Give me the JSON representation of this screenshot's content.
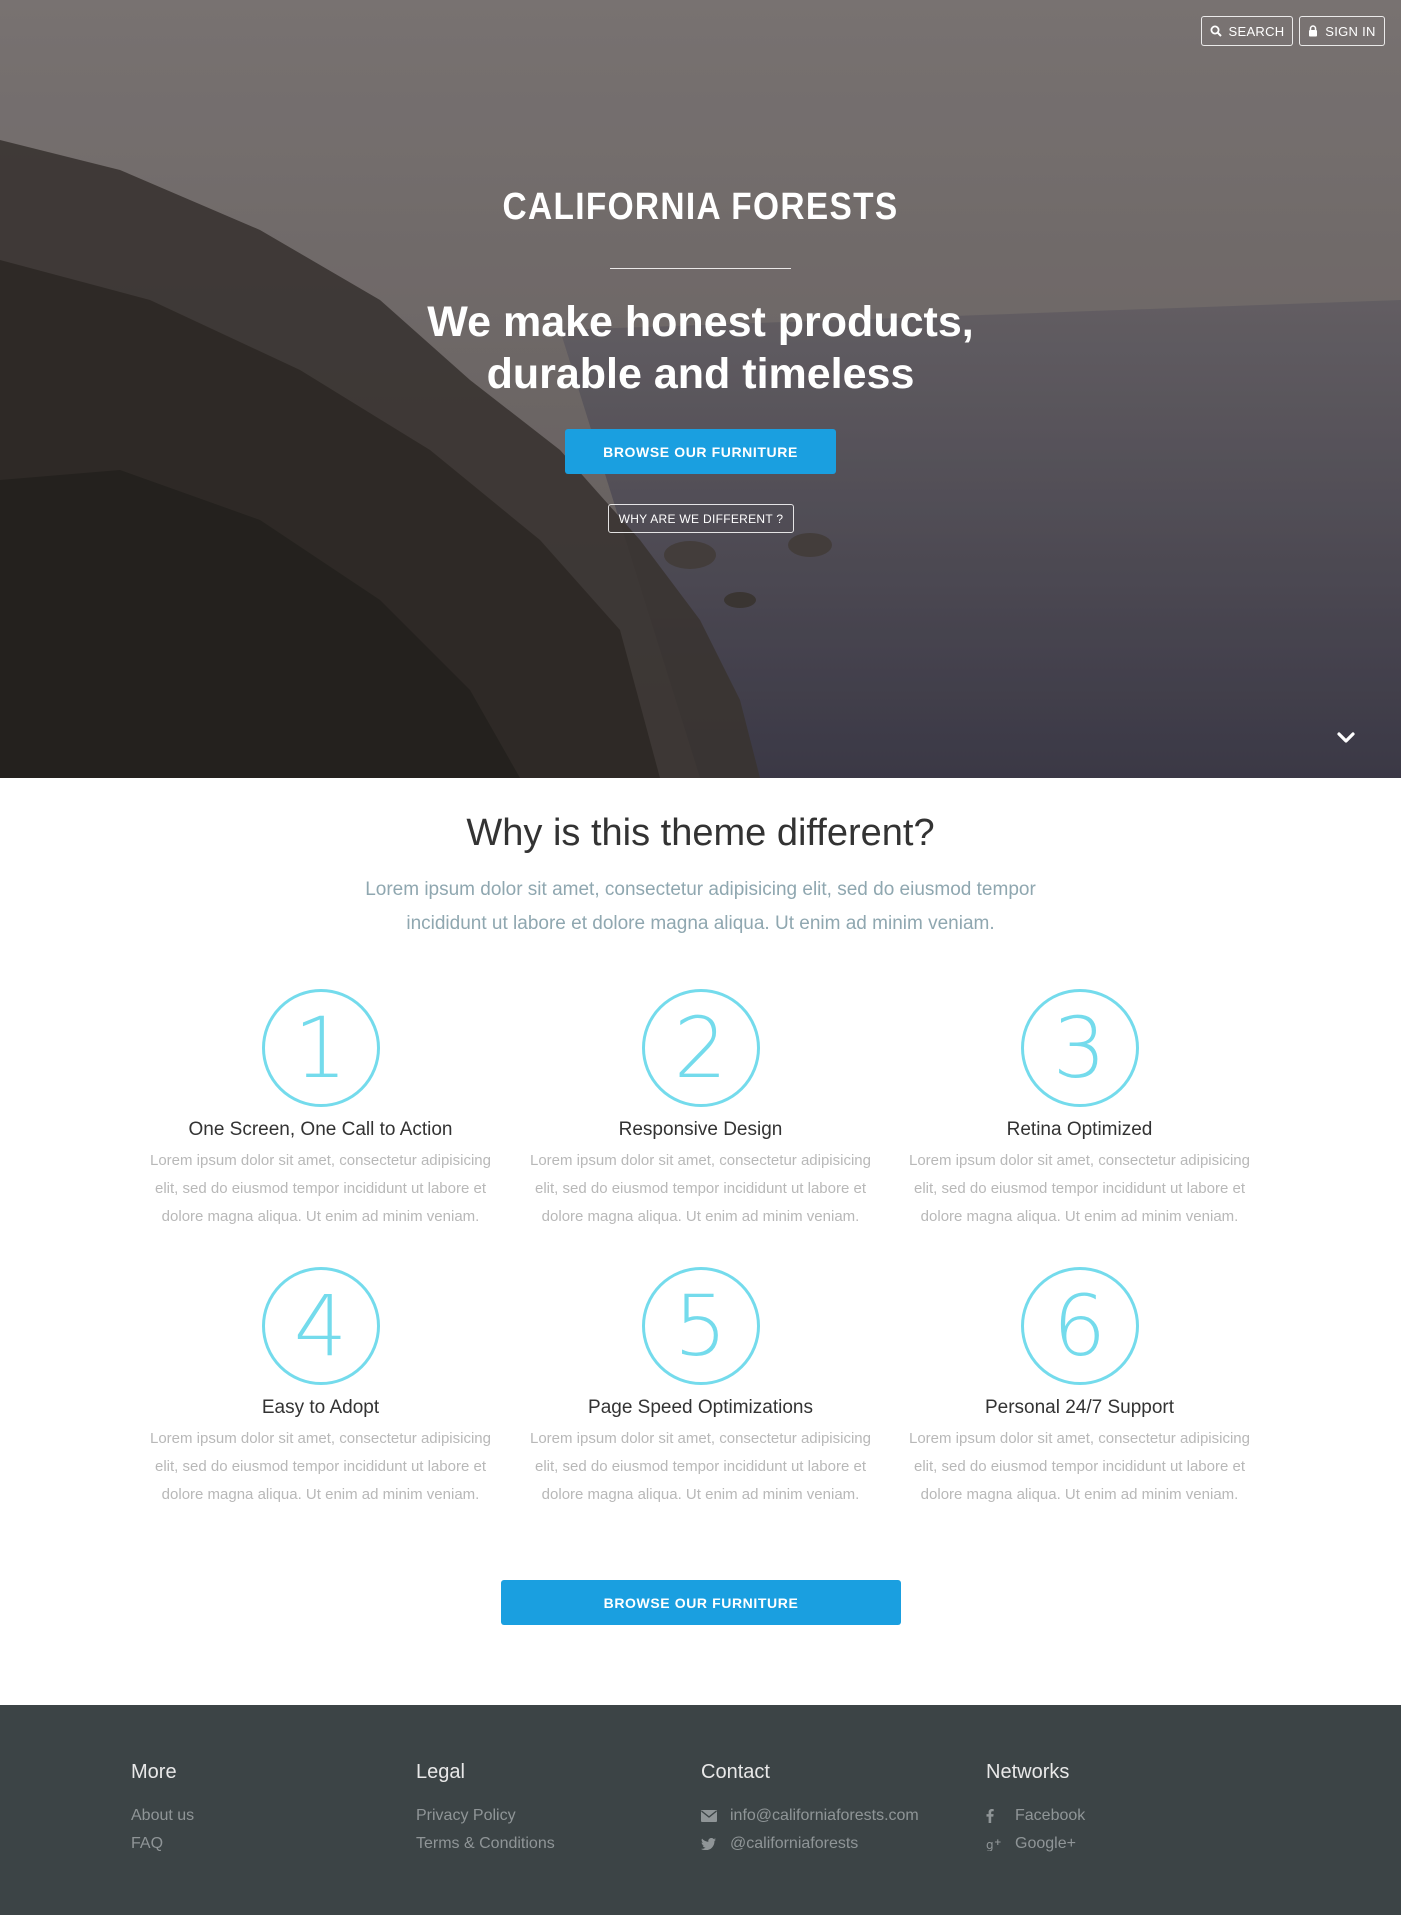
{
  "header": {
    "search_label": "SEARCH",
    "signin_label": "SIGN IN"
  },
  "hero": {
    "brand": "CALIFORNIA FORESTS",
    "headline_line1": "We make honest products,",
    "headline_line2": "durable and timeless",
    "cta_label": "BROWSE OUR FURNITURE",
    "secondary_label": "WHY ARE WE DIFFERENT ?"
  },
  "features": {
    "title": "Why is this theme different?",
    "subtitle": "Lorem ipsum dolor sit amet, consectetur adipisicing elit, sed do eiusmod tempor incididunt ut labore et dolore magna aliqua. Ut enim ad minim veniam.",
    "items": [
      {
        "number": "1",
        "title": "One Screen, One Call to Action",
        "text": "Lorem ipsum dolor sit amet, consectetur adipisicing elit, sed do eiusmod tempor incididunt ut labore et dolore magna aliqua. Ut enim ad minim veniam."
      },
      {
        "number": "2",
        "title": "Responsive Design",
        "text": "Lorem ipsum dolor sit amet, consectetur adipisicing elit, sed do eiusmod tempor incididunt ut labore et dolore magna aliqua. Ut enim ad minim veniam."
      },
      {
        "number": "3",
        "title": "Retina Optimized",
        "text": "Lorem ipsum dolor sit amet, consectetur adipisicing elit, sed do eiusmod tempor incididunt ut labore et dolore magna aliqua. Ut enim ad minim veniam."
      },
      {
        "number": "4",
        "title": "Easy to Adopt",
        "text": "Lorem ipsum dolor sit amet, consectetur adipisicing elit, sed do eiusmod tempor incididunt ut labore et dolore magna aliqua. Ut enim ad minim veniam."
      },
      {
        "number": "5",
        "title": "Page Speed Optimizations",
        "text": "Lorem ipsum dolor sit amet, consectetur adipisicing elit, sed do eiusmod tempor incididunt ut labore et dolore magna aliqua. Ut enim ad minim veniam."
      },
      {
        "number": "6",
        "title": "Personal 24/7 Support",
        "text": "Lorem ipsum dolor sit amet, consectetur adipisicing elit, sed do eiusmod tempor incididunt ut labore et dolore magna aliqua. Ut enim ad minim veniam."
      }
    ],
    "cta_label": "BROWSE OUR FURNITURE"
  },
  "footer": {
    "more": {
      "title": "More",
      "links": [
        "About us",
        "FAQ"
      ]
    },
    "legal": {
      "title": "Legal",
      "links": [
        "Privacy Policy",
        "Terms & Conditions"
      ]
    },
    "contact": {
      "title": "Contact",
      "email": "info@californiaforests.com",
      "twitter": "@californiaforests"
    },
    "networks": {
      "title": "Networks",
      "facebook": "Facebook",
      "googleplus": "Google+"
    }
  },
  "colors": {
    "accent": "#1a9fe0",
    "circle": "#74dbec",
    "footer_bg": "#3c4446",
    "subtitle": "#8fa7b0"
  },
  "icons": [
    "search-icon",
    "lock-icon",
    "chevron-down-icon",
    "envelope-icon",
    "twitter-icon",
    "facebook-icon",
    "google-plus-icon"
  ]
}
